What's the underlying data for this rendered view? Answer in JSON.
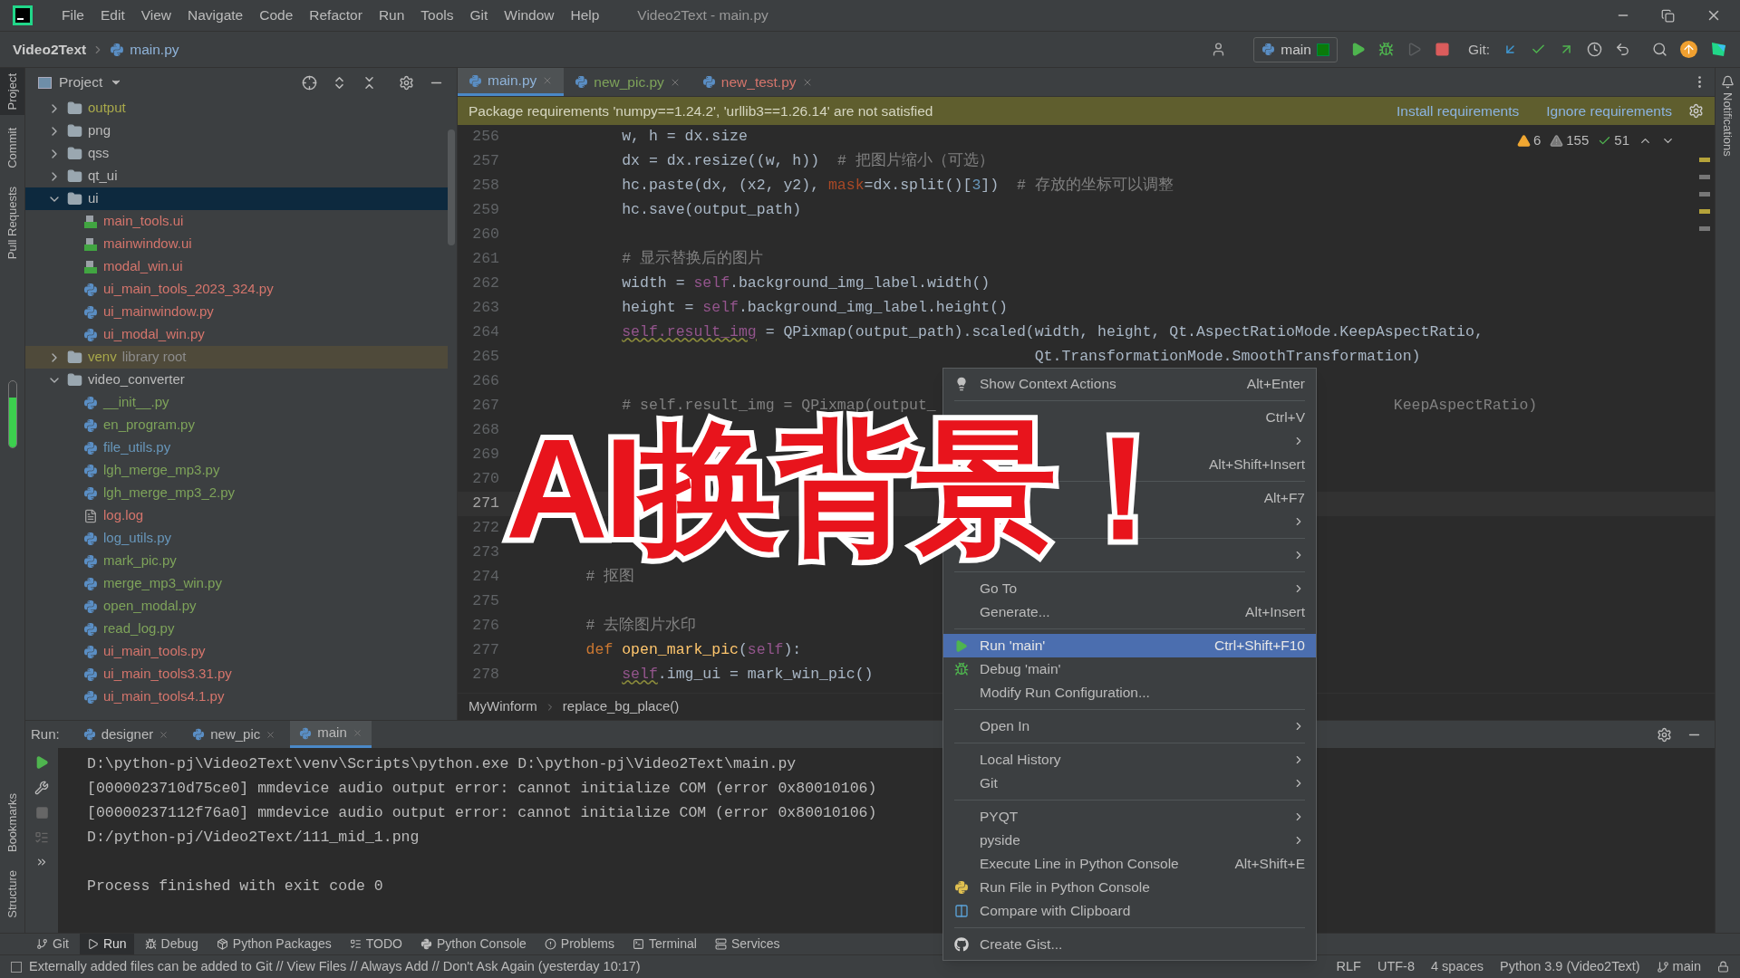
{
  "title_bar": {
    "menus": [
      "File",
      "Edit",
      "View",
      "Navigate",
      "Code",
      "Refactor",
      "Run",
      "Tools",
      "Git",
      "Window",
      "Help"
    ],
    "title": "Video2Text - main.py"
  },
  "nav_bar": {
    "project": "Video2Text",
    "file": "main.py",
    "run_config": "main",
    "git_label": "Git:"
  },
  "left_strip": {
    "top": [
      {
        "label": "Project",
        "selected": true
      },
      {
        "label": "Commit",
        "selected": false
      },
      {
        "label": "Pull Requests",
        "selected": false
      }
    ],
    "bottom": [
      {
        "label": "Bookmarks",
        "selected": false
      },
      {
        "label": "Structure",
        "selected": false
      }
    ]
  },
  "project_panel": {
    "title": "Project",
    "tree": [
      {
        "name": "output",
        "kind": "folder",
        "color": "#a9a94b",
        "selected": false,
        "expanded": false
      },
      {
        "name": "png",
        "kind": "folder",
        "color": "#bbbbbb",
        "selected": false,
        "expanded": false
      },
      {
        "name": "qss",
        "kind": "folder",
        "color": "#bbbbbb",
        "selected": false,
        "expanded": false
      },
      {
        "name": "qt_ui",
        "kind": "folder",
        "color": "#bbbbbb",
        "selected": false,
        "expanded": false
      },
      {
        "name": "ui",
        "kind": "folder",
        "color": "#bbbbbb",
        "selected": true,
        "expanded": true,
        "children": [
          {
            "name": "main_tools.ui",
            "kind": "qt",
            "color": "#d5756c",
            "selected": false
          },
          {
            "name": "mainwindow.ui",
            "kind": "qt",
            "color": "#d5756c",
            "selected": false
          },
          {
            "name": "modal_win.ui",
            "kind": "qt",
            "color": "#d5756c",
            "selected": false
          },
          {
            "name": "ui_main_tools_2023_324.py",
            "kind": "py",
            "color": "#d5756c",
            "selected": false
          },
          {
            "name": "ui_mainwindow.py",
            "kind": "py",
            "color": "#d5756c",
            "selected": false
          },
          {
            "name": "ui_modal_win.py",
            "kind": "py",
            "color": "#d5756c",
            "selected": false
          }
        ]
      },
      {
        "name": "venv",
        "hint": "library root",
        "kind": "library_folder",
        "color": "#a9a94b",
        "selected": false,
        "expanded": false
      },
      {
        "name": "video_converter",
        "kind": "folder",
        "color": "#bbbbbb",
        "selected": false,
        "expanded": true,
        "children": [
          {
            "name": "__init__.py",
            "kind": "py",
            "color": "#7ea35a",
            "selected": false
          },
          {
            "name": "en_program.py",
            "kind": "py",
            "color": "#7ea35a",
            "selected": false
          },
          {
            "name": "file_utils.py",
            "kind": "py",
            "color": "#6897bb",
            "selected": false
          },
          {
            "name": "lgh_merge_mp3.py",
            "kind": "py",
            "color": "#7ea35a",
            "selected": false
          },
          {
            "name": "lgh_merge_mp3_2.py",
            "kind": "py",
            "color": "#7ea35a",
            "selected": false
          },
          {
            "name": "log.log",
            "kind": "text",
            "color": "#d5756c",
            "selected": false
          },
          {
            "name": "log_utils.py",
            "kind": "py",
            "color": "#6897bb",
            "selected": false
          },
          {
            "name": "mark_pic.py",
            "kind": "py",
            "color": "#7ea35a",
            "selected": false
          },
          {
            "name": "merge_mp3_win.py",
            "kind": "py",
            "color": "#7ea35a",
            "selected": false
          },
          {
            "name": "open_modal.py",
            "kind": "py",
            "color": "#7ea35a",
            "selected": false
          },
          {
            "name": "read_log.py",
            "kind": "py",
            "color": "#7ea35a",
            "selected": false
          },
          {
            "name": "ui_main_tools.py",
            "kind": "py",
            "color": "#d5756c",
            "selected": false
          },
          {
            "name": "ui_main_tools3.31.py",
            "kind": "py",
            "color": "#d5756c",
            "selected": false
          },
          {
            "name": "ui_main_tools4.1.py",
            "kind": "py",
            "color": "#d5756c",
            "selected": false
          }
        ]
      }
    ]
  },
  "editor": {
    "tabs": [
      {
        "label": "main.py",
        "color": "#8fb3d9",
        "selected": true
      },
      {
        "label": "new_pic.py",
        "color": "#7ea35a",
        "selected": false
      },
      {
        "label": "new_test.py",
        "color": "#d5756c",
        "selected": false
      }
    ],
    "banner": {
      "message": "Package requirements 'numpy==1.24.2', 'urllib3==1.26.14' are not satisfied",
      "links": [
        "Install requirements",
        "Ignore requirements"
      ]
    },
    "inspections": [
      {
        "kind": "warning",
        "count": "6"
      },
      {
        "kind": "weak",
        "count": "155"
      },
      {
        "kind": "ok",
        "count": "51"
      }
    ],
    "lines": [
      {
        "number": "256",
        "current": false,
        "tokens": [
          {
            "kind": "plain",
            "text": "        w, h = dx.size"
          }
        ]
      },
      {
        "number": "257",
        "current": false,
        "tokens": [
          {
            "kind": "plain",
            "text": "        dx = dx.resize((w, h))"
          },
          {
            "kind": "comment",
            "text": "  # 把图片缩小（可选）"
          }
        ]
      },
      {
        "number": "258",
        "current": false,
        "tokens": [
          {
            "kind": "plain",
            "text": "        hc.paste(dx, (x2, y2), "
          },
          {
            "kind": "param",
            "text": "mask"
          },
          {
            "kind": "plain",
            "text": "=dx.split()["
          },
          {
            "kind": "number",
            "text": "3"
          },
          {
            "kind": "plain",
            "text": "])"
          },
          {
            "kind": "comment",
            "text": "  # 存放的坐标可以调整"
          }
        ]
      },
      {
        "number": "259",
        "current": false,
        "tokens": [
          {
            "kind": "plain",
            "text": "        hc.save(output_path)"
          }
        ]
      },
      {
        "number": "260",
        "current": false
      },
      {
        "number": "261",
        "current": false,
        "tokens": [
          {
            "kind": "comment",
            "text": "        # 显示替换后的图片"
          }
        ]
      },
      {
        "number": "262",
        "current": false,
        "tokens": [
          {
            "kind": "plain",
            "text": "        width = "
          },
          {
            "kind": "self",
            "text": "self"
          },
          {
            "kind": "plain",
            "text": ".background_img_label.width()"
          }
        ]
      },
      {
        "number": "263",
        "current": false,
        "tokens": [
          {
            "kind": "plain",
            "text": "        height = "
          },
          {
            "kind": "self",
            "text": "self"
          },
          {
            "kind": "plain",
            "text": ".background_img_label.height()"
          }
        ]
      },
      {
        "number": "264",
        "current": false,
        "tokens": [
          {
            "kind": "self_warn",
            "text": "        self.result_img"
          },
          {
            "kind": "plain",
            "text": " = QPixmap(output_path).scaled(width, height, Qt.AspectRatioMode.KeepAspectRatio,"
          }
        ]
      },
      {
        "number": "265",
        "current": false,
        "tokens": [
          {
            "kind": "plain",
            "text": "                                                      Qt.TransformationMode.SmoothTransformation)"
          }
        ]
      },
      {
        "number": "266",
        "current": false
      },
      {
        "number": "267",
        "current": false,
        "tokens": [
          {
            "kind": "comment",
            "text": "        # self.result_img = QPixmap(output_"
          },
          {
            "kind": "comment",
            "text": "                                                   KeepAspectRatio)"
          }
        ]
      },
      {
        "number": "268",
        "current": false
      },
      {
        "number": "269",
        "current": false
      },
      {
        "number": "270",
        "current": false
      },
      {
        "number": "271",
        "current": true
      },
      {
        "number": "272",
        "current": false
      },
      {
        "number": "273",
        "current": false
      },
      {
        "number": "274",
        "current": false,
        "tokens": [
          {
            "kind": "comment",
            "text": "    # 抠图"
          }
        ]
      },
      {
        "number": "275",
        "current": false
      },
      {
        "number": "276",
        "current": false,
        "tokens": [
          {
            "kind": "comment",
            "text": "    # 去除图片水印"
          }
        ]
      },
      {
        "number": "277",
        "current": false,
        "tokens": [
          {
            "kind": "keyword",
            "text": "    def "
          },
          {
            "kind": "func",
            "text": "open_mark_pic"
          },
          {
            "kind": "plain",
            "text": "("
          },
          {
            "kind": "self",
            "text": "self"
          },
          {
            "kind": "plain",
            "text": "):"
          }
        ]
      },
      {
        "number": "278",
        "current": false,
        "tokens": [
          {
            "kind": "self_warn",
            "text": "        self"
          },
          {
            "kind": "plain",
            "text": ".img_ui = mark_win_pic()"
          }
        ]
      }
    ],
    "breadcrumbs": [
      "MyWinform",
      "replace_bg_place()"
    ]
  },
  "run_panel": {
    "label": "Run:",
    "tabs": [
      {
        "label": "designer",
        "selected": false
      },
      {
        "label": "new_pic",
        "selected": false
      },
      {
        "label": "main",
        "selected": true
      }
    ],
    "output": [
      {
        "kind": "line",
        "text": "D:\\python-pj\\Video2Text\\venv\\Scripts\\python.exe D:\\python-pj\\Video2Text\\main.py"
      },
      {
        "kind": "line",
        "text": "[0000023710d75ce0] mmdevice audio output error: cannot initialize COM (error 0x80010106)"
      },
      {
        "kind": "line",
        "text": "[00000237112f76a0] mmdevice audio output error: cannot initialize COM (error 0x80010106)"
      },
      {
        "kind": "line",
        "text": "D:/python-pj/Video2Text/111_mid_1.png"
      },
      {
        "kind": "exit",
        "text": "Process finished with exit code 0"
      }
    ]
  },
  "context_menu": [
    {
      "kind": "bulb",
      "label": "Show Context Actions",
      "shortcut": "Alt+Enter",
      "submenu": false,
      "selected": false
    },
    {
      "kind": "separator"
    },
    {
      "kind": "plain",
      "shortcut": "Ctrl+V",
      "submenu": false,
      "selected": false
    },
    {
      "kind": "plain",
      "submenu": true,
      "selected": false
    },
    {
      "kind": "plain",
      "shortcut": "Alt+Shift+Insert",
      "submenu": false,
      "selected": false
    },
    {
      "kind": "separator"
    },
    {
      "kind": "plain",
      "shortcut": "Alt+F7",
      "submenu": false,
      "selected": false
    },
    {
      "kind": "plain",
      "submenu": true,
      "selected": false
    },
    {
      "kind": "separator"
    },
    {
      "kind": "plain",
      "submenu": true,
      "selected": false
    },
    {
      "kind": "separator"
    },
    {
      "kind": "plain",
      "label": "Go To",
      "submenu": true,
      "selected": false
    },
    {
      "kind": "plain",
      "label": "Generate...",
      "shortcut": "Alt+Insert",
      "submenu": false,
      "selected": false
    },
    {
      "kind": "separator"
    },
    {
      "kind": "run",
      "label": "Run 'main'",
      "shortcut": "Ctrl+Shift+F10",
      "submenu": false,
      "selected": true
    },
    {
      "kind": "debug",
      "label": "Debug 'main'",
      "submenu": false,
      "selected": false
    },
    {
      "kind": "plain",
      "label": "Modify Run Configuration...",
      "submenu": false,
      "selected": false
    },
    {
      "kind": "separator"
    },
    {
      "kind": "plain",
      "label": "Open In",
      "submenu": true,
      "selected": false
    },
    {
      "kind": "separator"
    },
    {
      "kind": "plain",
      "label": "Local History",
      "submenu": true,
      "selected": false
    },
    {
      "kind": "plain",
      "label": "Git",
      "submenu": true,
      "selected": false
    },
    {
      "kind": "separator"
    },
    {
      "kind": "plain",
      "label": "PYQT",
      "submenu": true,
      "selected": false
    },
    {
      "kind": "plain",
      "label": "pyside",
      "submenu": true,
      "selected": false
    },
    {
      "kind": "plain",
      "label": "Execute Line in Python Console",
      "shortcut": "Alt+Shift+E",
      "submenu": false,
      "selected": false
    },
    {
      "kind": "python",
      "label": "Run File in Python Console",
      "submenu": false,
      "selected": false
    },
    {
      "kind": "compare",
      "label": "Compare with Clipboard",
      "submenu": false,
      "selected": false
    },
    {
      "kind": "separator"
    },
    {
      "kind": "github",
      "label": "Create Gist...",
      "submenu": false,
      "selected": false
    }
  ],
  "tool_tabs": [
    {
      "kind": "git",
      "label": "Git",
      "selected": false
    },
    {
      "kind": "run",
      "label": "Run",
      "selected": true
    },
    {
      "kind": "debug",
      "label": "Debug",
      "selected": false
    },
    {
      "kind": "packages",
      "label": "Python Packages",
      "selected": false
    },
    {
      "kind": "todo",
      "label": "TODO",
      "selected": false
    },
    {
      "kind": "console",
      "label": "Python Console",
      "selected": false
    },
    {
      "kind": "problems",
      "label": "Problems",
      "selected": false
    },
    {
      "kind": "terminal",
      "label": "Terminal",
      "selected": false
    },
    {
      "kind": "services",
      "label": "Services",
      "selected": false
    }
  ],
  "status_bar": {
    "message": "Externally added files can be added to Git // View Files // Always Add // Don't Ask Again (yesterday 10:17)",
    "items": [
      "RLF",
      "UTF-8",
      "4 spaces",
      "Python 3.9 (Video2Text)"
    ],
    "branch": "main"
  },
  "right_strip": {
    "label": "Notifications"
  },
  "caption": "AI换背景！"
}
